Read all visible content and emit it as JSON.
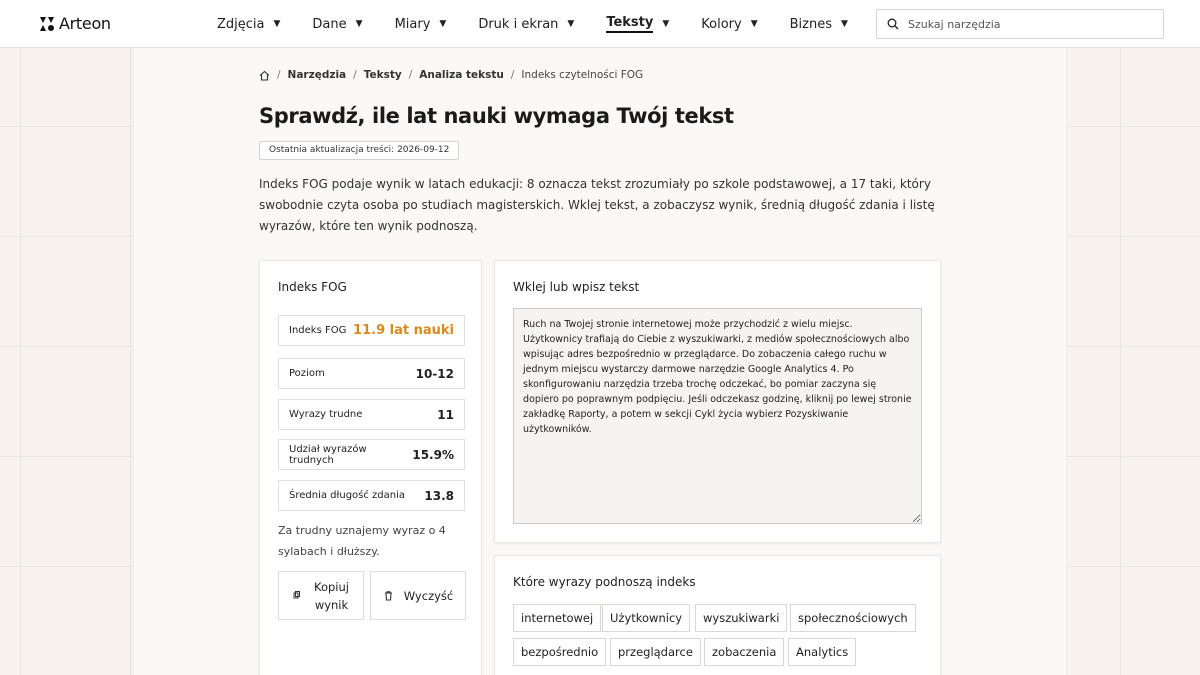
{
  "header": {
    "logo_text": "Arteon",
    "nav": [
      {
        "label": "Zdjęcia",
        "active": false
      },
      {
        "label": "Dane",
        "active": false
      },
      {
        "label": "Miary",
        "active": false
      },
      {
        "label": "Druk i ekran",
        "active": false
      },
      {
        "label": "Teksty",
        "active": true
      },
      {
        "label": "Kolory",
        "active": false
      },
      {
        "label": "Biznes",
        "active": false
      }
    ],
    "search_placeholder": "Szukaj narzędzia"
  },
  "breadcrumb": [
    "Narzędzia",
    "Teksty",
    "Analiza tekstu",
    "Indeks czytelności FOG"
  ],
  "page": {
    "title": "Sprawdź, ile lat nauki wymaga Twój tekst",
    "updated": "Ostatnia aktualizacja treści: 2026-09-12",
    "intro": "Indeks FOG podaje wynik w latach edukacji: 8 oznacza tekst zrozumiały po szkole podstawowej, a 17 taki, który swobodnie czyta osoba po studiach magisterskich. Wklej tekst, a zobaczysz wynik, średnią długość zdania i listę wyrazów, które ten wynik podnoszą."
  },
  "fog_card": {
    "title": "Indeks FOG",
    "stats": [
      {
        "label": "Indeks FOG",
        "value": "11.9 lat nauki"
      },
      {
        "label": "Poziom",
        "value": "10-12"
      },
      {
        "label": "Wyrazy trudne",
        "value": "11"
      },
      {
        "label": "Udział wyrazów trudnych",
        "value": "15.9%"
      },
      {
        "label": "Średnia długość zdania",
        "value": "13.8"
      }
    ],
    "note": "Za trudny uznajemy wyraz o 4 sylabach i dłuższy.",
    "copy_label": "Kopiuj wynik",
    "clear_label": "Wyczyść"
  },
  "input_card": {
    "title": "Wklej lub wpisz tekst",
    "text": "Ruch na Twojej stronie internetowej może przychodzić z wielu miejsc. Użytkownicy trafiają do Ciebie z wyszukiwarki, z mediów społecznościowych albo wpisując adres bezpośrednio w przeglądarce. Do zobaczenia całego ruchu w jednym miejscu wystarczy darmowe narzędzie Google Analytics 4. Po skonfigurowaniu narzędzia trzeba trochę odczekać, bo pomiar zaczyna się dopiero po poprawnym podpięciu. Jeśli odczekasz godzinę, kliknij po lewej stronie zakładkę Raporty, a potem w sekcji Cykl życia wybierz Pozyskiwanie użytkowników."
  },
  "words_card": {
    "title": "Które wyrazy podnoszą indeks",
    "words": [
      "internetowej",
      "Użytkownicy",
      "wyszukiwarki",
      "społecznościowych",
      "bezpośrednio",
      "przeglądarce",
      "zobaczenia",
      "Analytics"
    ]
  },
  "colors": {
    "accent": "#d98a1e",
    "background": "#f7f2ed",
    "panel": "#fbf8f5"
  }
}
